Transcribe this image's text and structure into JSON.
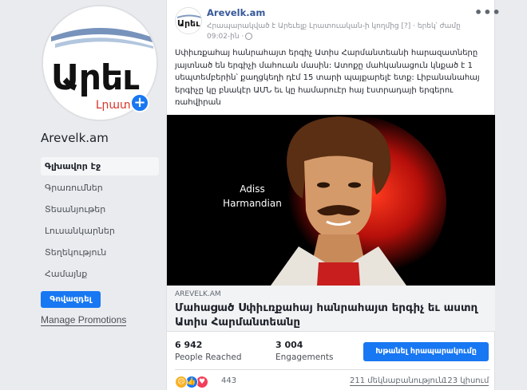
{
  "sidebar": {
    "avatar_text": "Արեւ",
    "avatar_subtext": "Լրատու",
    "page_name": "Arevelk.am",
    "nav": [
      {
        "label": "Գլխավոր էջ"
      },
      {
        "label": "Գրառումներ"
      },
      {
        "label": "Տեսանյութեր"
      },
      {
        "label": "Լուսանկարներ"
      },
      {
        "label": "Տեղեկություն"
      },
      {
        "label": "Համայնք"
      }
    ],
    "promote_label": "Գովազդել",
    "manage_promotions": "Manage Promotions"
  },
  "post": {
    "author": "Arevelk.am",
    "avatar_text": "Արեւ",
    "meta": "Հրապարակված է Արեւելք Լրատուական-ի կողմից [?] · երեկ՝ ժամը 09:02-ին ·",
    "more": "•••",
    "text": "Սփիւռքահայ հանրահայտ երգիչ Ատիս Հարմանտեանի հարազատները յայտնած են երգիչի մահուան մասին: Ատոքը մահկանացուն կնքած է 1 սեպտեմբերին՝ քաղցկեղի դէմ 15 տարի պայքարելէ ետք: Լիբանանահայ երգիչը կը բնակէր ԱՄՆ եւ կը համարուէր հայ էստրադայի երգերու ռահվիրան",
    "image_caption_line1": "Adiss",
    "image_caption_line2": "Harmandian",
    "link_domain": "AREVELK.AM",
    "link_title": "Մահացած Սփիւռքահայ հանրահայտ երգիչ եւ աստղ Ատիս Հարմանտեանը",
    "people_reached_value": "6 942",
    "people_reached_label": "People Reached",
    "engagements_value": "3 004",
    "engagements_label": "Engagements",
    "boost_label": "Խթանել հրապարակումը",
    "reactions_count": "443",
    "comments": "211 մեկնաբանություն",
    "shares": "123 կիսում"
  },
  "colors": {
    "brand_blue": "#1877f2",
    "link_blue": "#365899",
    "reaction_sad": "#f7b125",
    "reaction_like": "#1877f2",
    "reaction_love": "#f33e58"
  }
}
